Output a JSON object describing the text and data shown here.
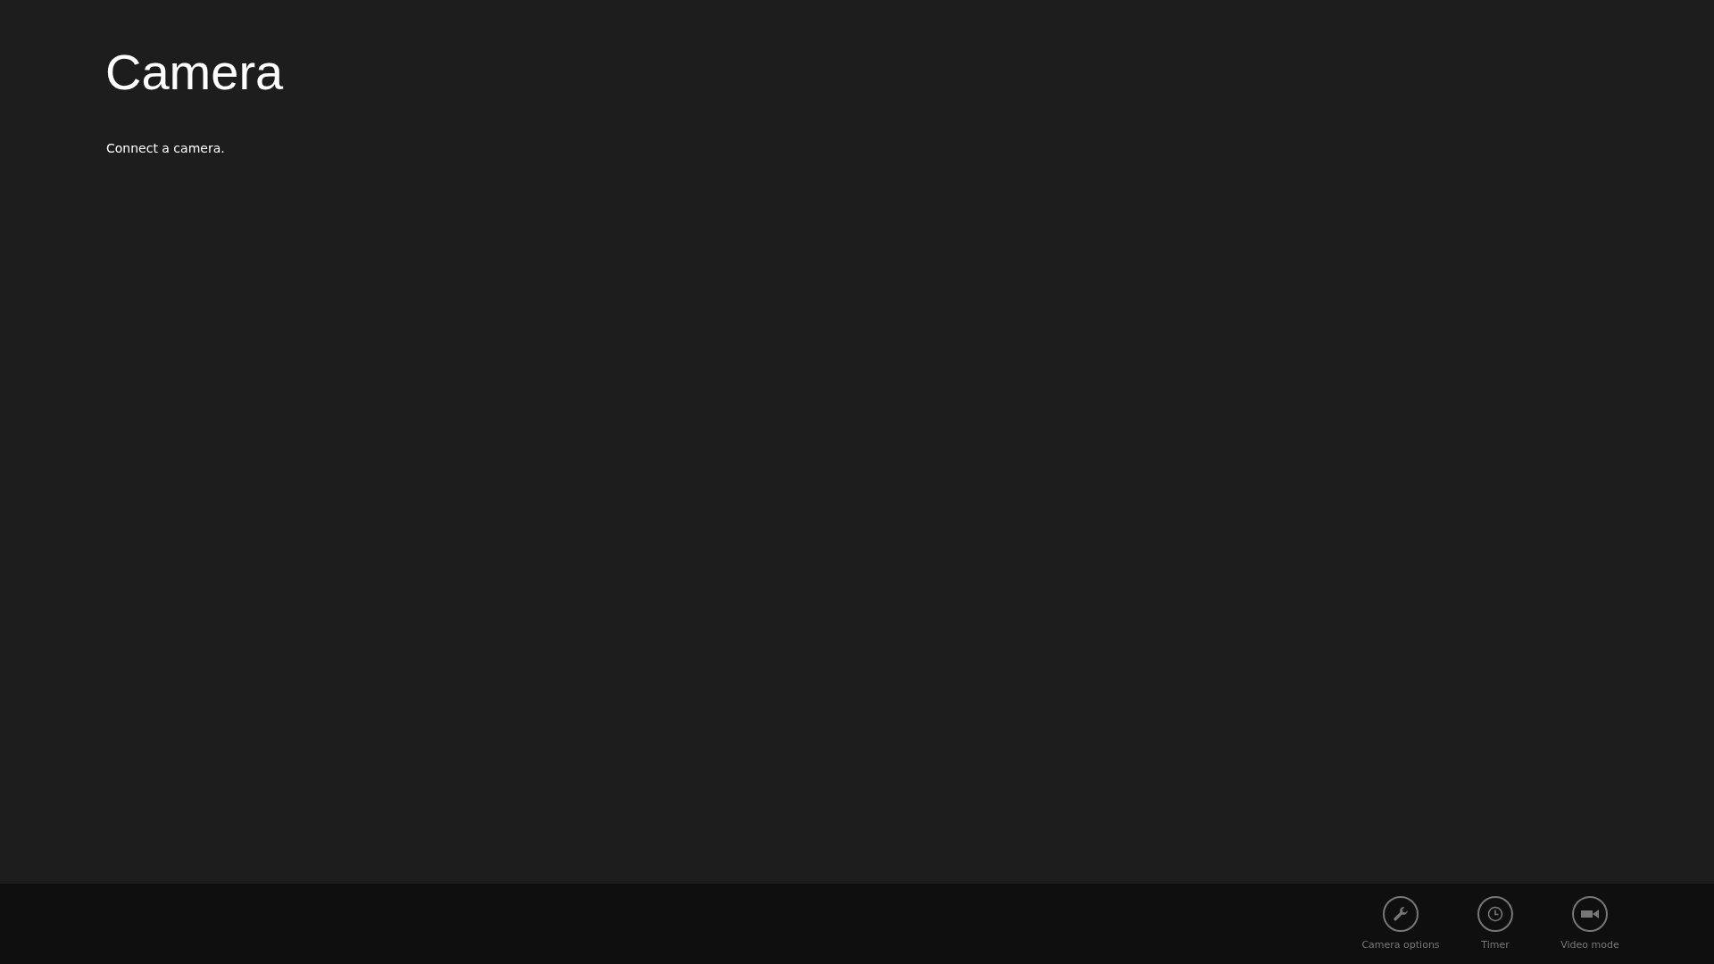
{
  "app": {
    "title": "Camera",
    "message": "Connect a camera."
  },
  "app_bar": {
    "buttons": [
      {
        "kind": "wrench",
        "label": "Camera options",
        "disabled": true
      },
      {
        "kind": "clock",
        "label": "Timer",
        "disabled": true
      },
      {
        "kind": "video",
        "label": "Video mode",
        "disabled": true
      }
    ]
  }
}
